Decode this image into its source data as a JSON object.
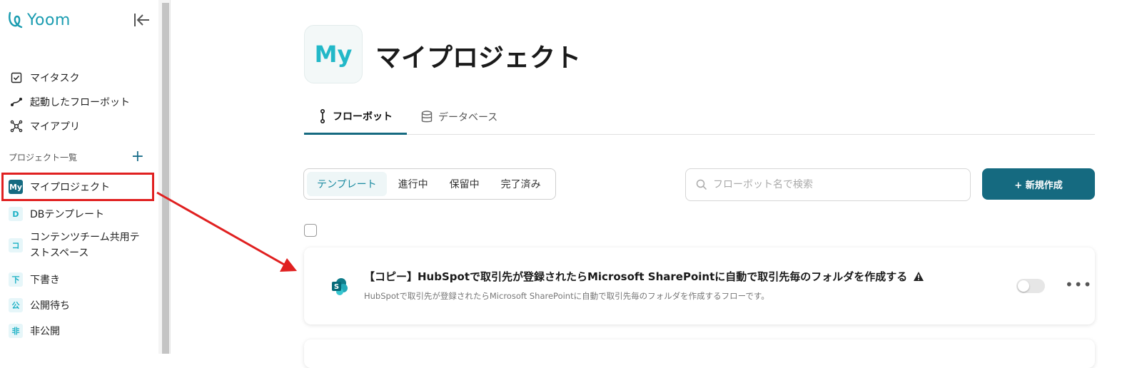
{
  "app": {
    "logo_text": "Yoom",
    "brand_color": "#1a9cb0",
    "accent_color": "#156a80"
  },
  "sidebar": {
    "nav": [
      {
        "label": "マイタスク",
        "icon": "checkbox-icon"
      },
      {
        "label": "起動したフローボット",
        "icon": "route-icon"
      },
      {
        "label": "マイアプリ",
        "icon": "network-icon"
      }
    ],
    "projects_header": "プロジェクト一覧",
    "add_label": "+",
    "projects": [
      {
        "badge": "My",
        "label": "マイプロジェクト",
        "active": true
      },
      {
        "badge": "D",
        "label": "DBテンプレート"
      },
      {
        "badge": "コ",
        "label": "コンテンツチーム共用テストスペース"
      },
      {
        "badge": "下",
        "label": "下書き"
      },
      {
        "badge": "公",
        "label": "公開待ち"
      },
      {
        "badge": "非",
        "label": "非公開"
      }
    ]
  },
  "main": {
    "hero_badge": "My",
    "title": "マイプロジェクト",
    "tabs": [
      {
        "label": "フローボット",
        "icon": "flow-icon",
        "active": true
      },
      {
        "label": "データベース",
        "icon": "database-icon"
      }
    ],
    "filters": [
      "テンプレート",
      "進行中",
      "保留中",
      "完了済み"
    ],
    "search_placeholder": "フローボット名で検索",
    "new_button": "+ 新規作成",
    "flows": [
      {
        "title": "【コピー】HubSpotで取引先が登録されたらMicrosoft SharePointに自動で取引先毎のフォルダを作成する",
        "description": "HubSpotで取引先が登録されたらMicrosoft SharePointに自動で取引先毎のフォルダを作成するフローです。",
        "icon": "sharepoint-icon",
        "warning_icon": "warning-icon",
        "enabled": false
      }
    ]
  },
  "annotation_color": "#e02020"
}
